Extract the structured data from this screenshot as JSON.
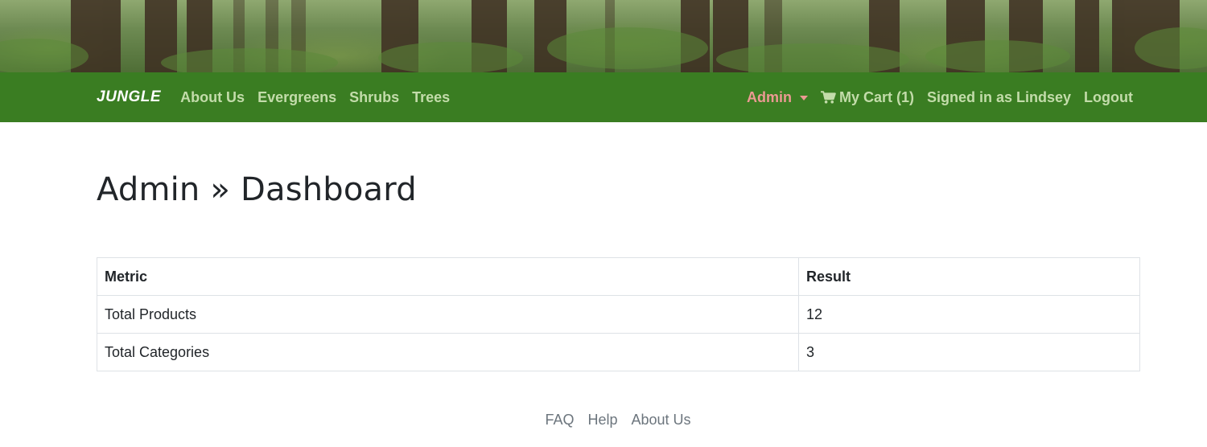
{
  "navbar": {
    "brand": "JUNGLE",
    "left_links": [
      {
        "label": "About Us"
      },
      {
        "label": "Evergreens"
      },
      {
        "label": "Shrubs"
      },
      {
        "label": "Trees"
      }
    ],
    "admin_label": "Admin",
    "cart_label": "My Cart (1)",
    "signed_in_label": "Signed in as Lindsey",
    "logout_label": "Logout",
    "colors": {
      "bar": "#3a7d22",
      "link": "#c3dcaa",
      "admin": "#ec9a93"
    }
  },
  "main": {
    "title": "Admin » Dashboard",
    "table": {
      "headers": [
        "Metric",
        "Result"
      ],
      "rows": [
        [
          "Total Products",
          "12"
        ],
        [
          "Total Categories",
          "3"
        ]
      ]
    }
  },
  "footer": {
    "links": [
      {
        "label": "FAQ"
      },
      {
        "label": "Help"
      },
      {
        "label": "About Us"
      }
    ]
  },
  "icons": {
    "cart": "shopping-cart-icon",
    "admin_dropdown": "caret-down-icon"
  }
}
